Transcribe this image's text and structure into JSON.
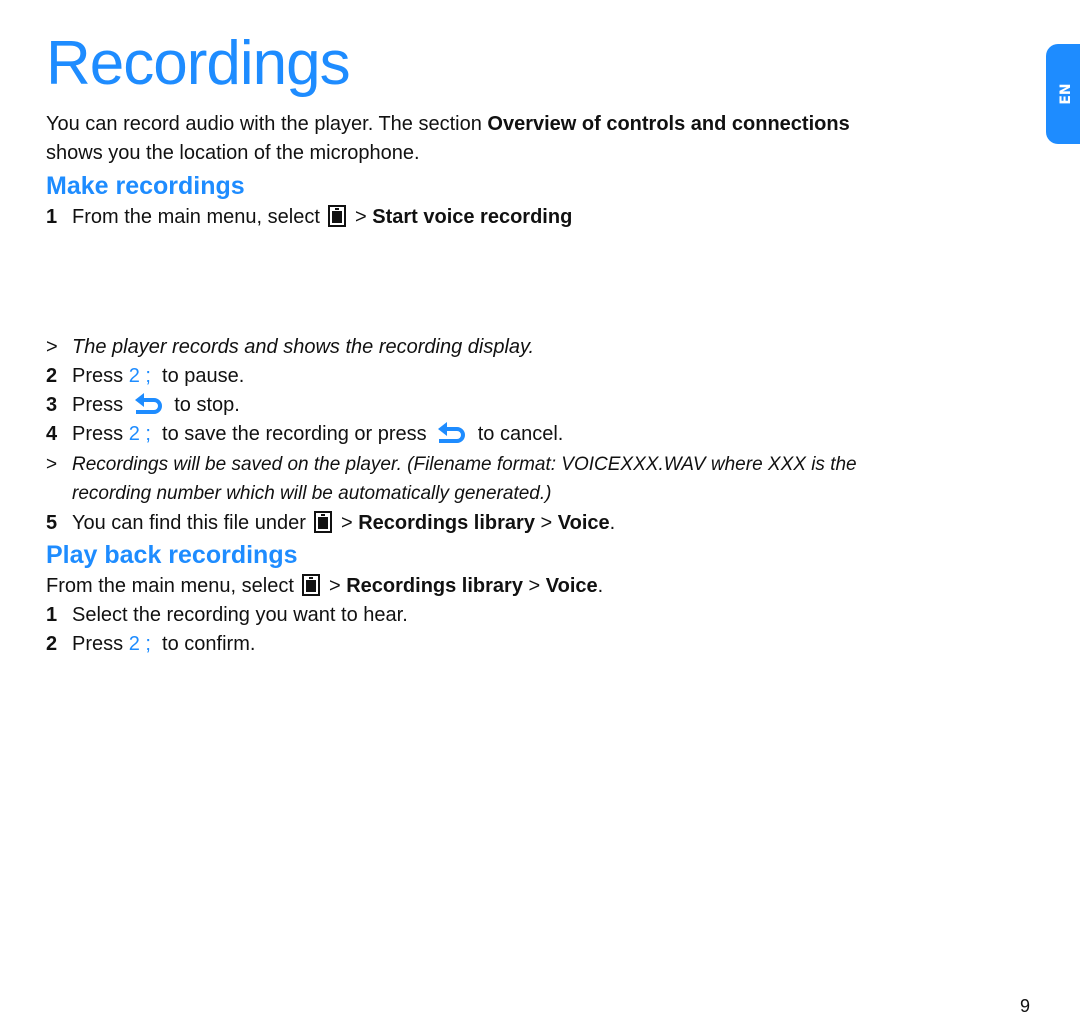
{
  "title": "Recordings",
  "intro": {
    "line1_pre": "You can record audio with the player. The section ",
    "line1_bold": "Overview of controls and connections",
    "line2": "shows you the location of the microphone."
  },
  "make": {
    "heading": "Make recordings",
    "step1": {
      "num": "1",
      "pre": "From the main menu, select ",
      "sep": " > ",
      "bold": "Start voice recording"
    },
    "note1": {
      "gt": ">",
      "text": "The player records and shows the recording display."
    },
    "step2": {
      "num": "2",
      "pre": "Press ",
      "key": "2 ;",
      "post": "  to pause."
    },
    "step3": {
      "num": "3",
      "pre": "Press ",
      "post": " to stop."
    },
    "step4": {
      "num": "4",
      "pre": "Press ",
      "key": "2 ;",
      "mid": "  to save the recording or press ",
      "post": " to cancel."
    },
    "note2": {
      "gt": ">",
      "line1": "Recordings will be saved on the player. (Filename format: VOICEXXX.WAV where XXX is the",
      "line2": "recording number which will be automatically generated.)"
    },
    "step5": {
      "num": "5",
      "pre": "You can find this file under ",
      "sep1": " > ",
      "bold1": "Recordings library",
      "sep2": " > ",
      "bold2": "Voice",
      "end": "."
    }
  },
  "play": {
    "heading": "Play back recordings",
    "intro": {
      "pre": "From the main menu, select ",
      "sep1": " > ",
      "bold1": "Recordings library",
      "sep2": " > ",
      "bold2": "Voice",
      "end": "."
    },
    "step1": {
      "num": "1",
      "text": "Select the recording you want to hear."
    },
    "step2": {
      "num": "2",
      "pre": "Press ",
      "key": "2 ;",
      "post": "  to confirm."
    }
  },
  "lang_tab": "EN",
  "page_number": "9",
  "colors": {
    "accent": "#1e8cff"
  },
  "icons": {
    "menu": "music-menu-icon",
    "back": "back-arrow-icon"
  }
}
